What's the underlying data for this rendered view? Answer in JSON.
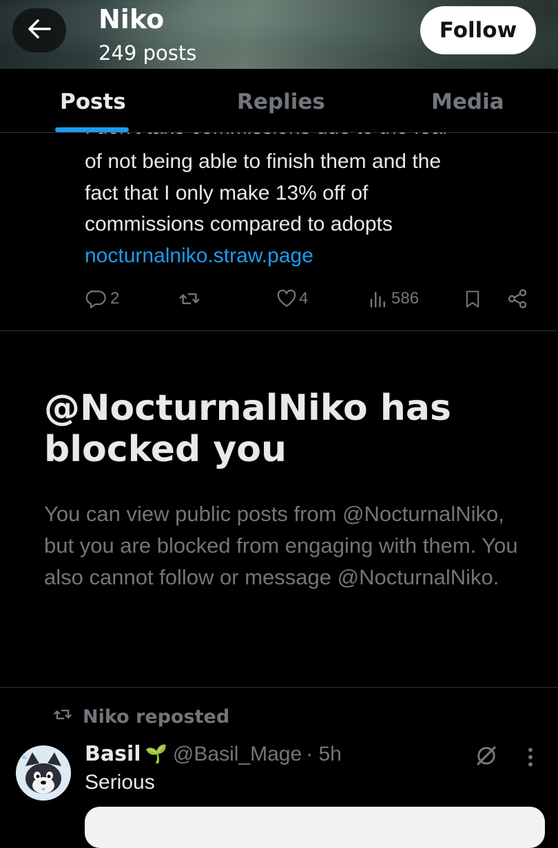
{
  "header": {
    "title": "Niko",
    "post_count": "249 posts",
    "follow_label": "Follow"
  },
  "tabs": [
    {
      "label": "Posts",
      "active": true
    },
    {
      "label": "Replies",
      "active": false
    },
    {
      "label": "Media",
      "active": false
    }
  ],
  "post": {
    "clipped_line": "I don't take commissions due to the fear",
    "lines": [
      "of not being able to finish them and the",
      "fact that I only make 13% off of",
      "commissions compared to adopts"
    ],
    "link": "nocturnalniko.straw.page",
    "actions": {
      "replies": "2",
      "reposts": "",
      "likes": "4",
      "views": "586"
    }
  },
  "blocked": {
    "title": "@NocturnalNiko has blocked you",
    "body": "You can view public posts from @NocturnalNiko, but you are blocked from engaging with them. You also cannot follow or message @NocturnalNiko."
  },
  "repost": {
    "label": "Niko reposted",
    "author_name": "Basil",
    "author_emoji": "🌱",
    "handle": "@Basil_Mage",
    "time": "· 5h",
    "text": "Serious"
  },
  "colors": {
    "accent": "#1d9bf0",
    "muted": "#71767b",
    "text": "#e7e9ea",
    "background": "#000000"
  },
  "icons": [
    "back-arrow-icon",
    "reply-icon",
    "repost-icon",
    "like-icon",
    "views-icon",
    "bookmark-icon",
    "share-icon",
    "grok-icon",
    "more-icon"
  ]
}
